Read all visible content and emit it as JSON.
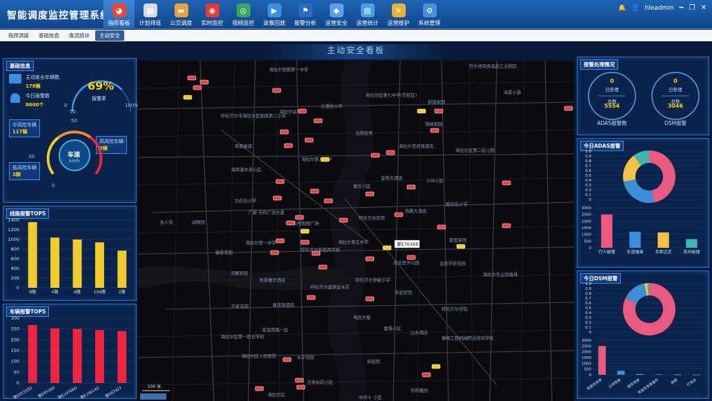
{
  "app": {
    "title": "智能调度监控管理系统"
  },
  "nav": [
    {
      "label": "指挥看板",
      "icon": "pie-chart-icon",
      "color": "#e44a3c",
      "active": true
    },
    {
      "label": "计划排班",
      "icon": "calendar-icon",
      "color": "#d9d9d9",
      "active": false
    },
    {
      "label": "公交调度",
      "icon": "bus-icon",
      "color": "#e8a23a",
      "active": false
    },
    {
      "label": "实时监控",
      "icon": "map-pin-icon",
      "color": "#e33b3b",
      "active": false
    },
    {
      "label": "视频监控",
      "icon": "camera-icon",
      "color": "#3aa55b",
      "active": false
    },
    {
      "label": "录像回放",
      "icon": "play-icon",
      "color": "#3c8fe0",
      "active": false
    },
    {
      "label": "报警分析",
      "icon": "alarm-icon",
      "color": "#2b6cc0",
      "active": false
    },
    {
      "label": "运营安全",
      "icon": "shield-icon",
      "color": "#5aa0e8",
      "active": false
    },
    {
      "label": "运营统计",
      "icon": "monitor-chart-icon",
      "color": "#4aa0e0",
      "active": false
    },
    {
      "label": "运营维护",
      "icon": "tools-icon",
      "color": "#e8b23a",
      "active": false
    },
    {
      "label": "系统管理",
      "icon": "settings-monitor-icon",
      "color": "#4a90d8",
      "active": false
    }
  ],
  "user": {
    "name": "hleadmin",
    "bell_icon": "bell-icon",
    "user_icon": "user-icon"
  },
  "subtabs": [
    {
      "label": "指挥调度",
      "active": false
    },
    {
      "label": "基础信息",
      "active": false
    },
    {
      "label": "客流统计",
      "active": false
    },
    {
      "label": "主动安全",
      "active": true
    }
  ],
  "board": {
    "title": "主动安全看板"
  },
  "basic_info": {
    "title": "基础信息",
    "active_safety_label": "主动安全车辆数",
    "active_safety_value": "178辆",
    "today_alarm_label": "今日报警数",
    "today_alarm_value": "8600个",
    "alarm_rate_value": "69%",
    "alarm_rate_label": "报警率",
    "rate_ticks": [
      "0",
      "50",
      "100%"
    ],
    "mid_risk_label": "中风险车辆",
    "mid_risk_value": "117辆",
    "high_risk_label": "高风险车辆",
    "high_risk_value": "3辆",
    "low_risk_label": "低风险车辆",
    "low_risk_value": "3辆",
    "speed_label": "车速",
    "speed_unit": "km/h",
    "speed_ticks": [
      "0",
      "30",
      "50"
    ]
  },
  "route_top5": {
    "title": "线路报警TOP5",
    "chart_data": {
      "type": "bar",
      "categories": [
        "9路",
        "4路",
        "6路",
        "104路",
        "2路"
      ],
      "values": [
        1360,
        1040,
        1000,
        940,
        770
      ],
      "ylim": [
        0,
        1400
      ],
      "yticks": [
        "0",
        "200",
        "400",
        "600",
        "800",
        "1000",
        "1200",
        "1400"
      ],
      "color": "#f2cc2e"
    }
  },
  "vehicle_top5": {
    "title": "车辆报警TOP5",
    "chart_data": {
      "type": "bar",
      "categories": [
        "蒙E05333D",
        "蒙E85269",
        "蒙E19766D",
        "蒙E19614D",
        "蒙E82927"
      ],
      "values": [
        268,
        253,
        250,
        245,
        240
      ],
      "ylim": [
        0,
        300
      ],
      "yticks": [
        "0",
        "50",
        "100",
        "150",
        "200",
        "250",
        "300"
      ],
      "color": "#f0253f"
    }
  },
  "alarm_handling": {
    "title": "报警处理情况",
    "adas": {
      "processed_value": "0",
      "processed_label": "已处理",
      "total_label": "总数",
      "total_value": "5554",
      "caption": "ADAS报警数"
    },
    "dsm": {
      "processed_value": "0",
      "processed_label": "已处理",
      "total_label": "总数",
      "total_value": "3046",
      "caption": "DSM报警"
    }
  },
  "adas_today": {
    "title": "今日ADAS报警",
    "pie": {
      "type": "pie",
      "values": [
        47,
        25,
        18,
        10
      ],
      "colors": [
        "#e95a7e",
        "#3b8fd8",
        "#f1c246",
        "#3db7b0"
      ]
    },
    "pie_axis": [
      "0",
      "0.1",
      "0.2",
      "0.3",
      "0.4",
      "0.5",
      "0.6",
      "0.7",
      "0.8",
      "0.9",
      "1.0"
    ],
    "bar": {
      "type": "bar",
      "categories": [
        "行人碰撞",
        "车道偏离",
        "车距过近",
        "前向碰撞"
      ],
      "values": [
        2500,
        1200,
        1150,
        650
      ],
      "colors": [
        "#e95a7e",
        "#3b8fd8",
        "#f1c246",
        "#3db7b0"
      ],
      "ylim": [
        0,
        3000
      ],
      "yticks": [
        "0",
        "500",
        "1000",
        "1500",
        "2000",
        "2500",
        "3000"
      ]
    }
  },
  "dsm_today": {
    "title": "今日DSM报警",
    "pie": {
      "type": "pie",
      "values": [
        82,
        15,
        2,
        1
      ],
      "colors": [
        "#e95a7e",
        "#3b8fd8",
        "#f1c246",
        "#3db7b0"
      ]
    },
    "pie_axis": [
      "0",
      "0.1",
      "0.2",
      "0.3",
      "0.4",
      "0.5",
      "0.6",
      "0.7",
      "0.8",
      "0.9",
      "1.0"
    ],
    "bar": {
      "type": "bar",
      "categories": [
        "驾驶员异常",
        "分神驾驶",
        "疲劳驾驶",
        "驾驶员变更事件",
        "抽烟",
        "打电话"
      ],
      "values": [
        2500,
        350,
        60,
        40,
        20,
        15
      ],
      "colors": [
        "#e95a7e",
        "#3b8fd8",
        "#3db7b0",
        "#3db7b0",
        "#f1c246",
        "#f1c246"
      ],
      "ylim": [
        0,
        3000
      ],
      "yticks": [
        "0",
        "500",
        "1000",
        "1500",
        "2000",
        "2500",
        "3000"
      ]
    }
  },
  "map": {
    "scale_label": "500 米",
    "labels": [
      "海拉尔铁路第一中学",
      "呼伦贝尔市海拉尔区铁路第二小学",
      "海拉尔站",
      "草原康城",
      "海铁道木床小区",
      "文化街小学",
      "名人街",
      "动物园",
      "广厦·东码广场大厦",
      "伊华丹购物广场",
      "海拉尔第一中学",
      "呼伦贝尔新都商贸城",
      "御景花园",
      "鸿雁家园",
      "凯景嘉华酒店",
      "呼伦贝尔盛源金水岸",
      "万家花园",
      "友谊南路一区",
      "海拉尔区第一职业学校",
      "海拉尔区人民医院",
      "水岸花园",
      "王英站前小区",
      "海拉尔区",
      "海拉尔区第七中学(东校区)",
      "兴港街小学",
      "北园桂亮",
      "海拉尔第八中学",
      "嘉华小区",
      "金晓大酒店",
      "海拉尔第五中学",
      "呼伦贝尔宾馆",
      "成吉思汗公园",
      "呼伦贝尔伊敏小学",
      "天骄宾馆",
      "电信大楼",
      "富强小区",
      "科技馆",
      "山水酒店",
      "学府嘉园",
      "和谐家园",
      "锦绣家园",
      "海拉尔百府强酒店",
      "海拉尔区第二幼儿园",
      "109小区",
      "怡鹏大酒店",
      "胜利街小学",
      "紫阳家园",
      "龙凤学府花园",
      "海拉尔东山凤凰场",
      "呼伦贝尔学院",
      "春畅工程机械职业培训学校",
      "巴尔虎肉食品加工业园区",
      "海景小镇",
      "中共十 小区",
      "春世源酒店"
    ],
    "vehicle_tooltip": "蒙E76368"
  }
}
